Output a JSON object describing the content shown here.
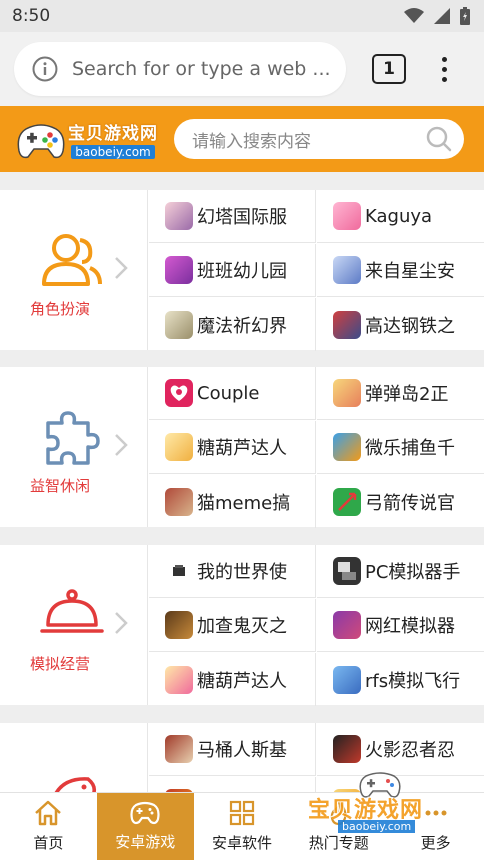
{
  "status_bar": {
    "time": "8:50",
    "icons": [
      "wifi-icon",
      "signal-icon",
      "battery-icon"
    ]
  },
  "browser": {
    "url_placeholder": "Search for or type a web ...",
    "info_icon": "info-icon",
    "tab_count": "1",
    "menu_icon": "more-vert-icon"
  },
  "site_header": {
    "logo_cn": "宝贝游戏网",
    "logo_en": "baobeiy.com",
    "search_placeholder": "请输入搜索内容",
    "colors": {
      "header_bg": "#f39a17",
      "accent_red": "#e23b3b",
      "nav_active": "#d8952b"
    }
  },
  "categories": [
    {
      "label": "角色扮演",
      "icon": "people-icon",
      "apps": [
        "幻塔国际服",
        "Kaguya",
        "班班幼儿园",
        "来自星尘安",
        "魔法祈幻界",
        "高达钢铁之"
      ]
    },
    {
      "label": "益智休闲",
      "icon": "puzzle-icon",
      "apps": [
        "Couple",
        "弹弹岛2正",
        "糖葫芦达人",
        "微乐捕鱼千",
        "猫meme搞",
        "弓箭传说官"
      ]
    },
    {
      "label": "模拟经营",
      "icon": "service-bell-icon",
      "apps": [
        "我的世界使",
        "PC模拟器手",
        "加查鬼灭之",
        "网红模拟器",
        "糖葫芦达人",
        "rfs模拟飞行"
      ]
    },
    {
      "label": "",
      "icon": "fish-icon",
      "apps": [
        "马桶人斯基",
        "火影忍者忍"
      ]
    }
  ],
  "bottom_nav": [
    {
      "label": "首页",
      "icon": "home-icon"
    },
    {
      "label": "安卓游戏",
      "icon": "gamepad-icon",
      "active": true
    },
    {
      "label": "安卓软件",
      "icon": "apps-grid-icon"
    },
    {
      "label": "热门专题",
      "icon": "fire-icon"
    },
    {
      "label": "更多",
      "icon": "more-icon"
    }
  ],
  "watermark": {
    "cn": "宝贝游戏网",
    "en": "baobeiy.com"
  }
}
